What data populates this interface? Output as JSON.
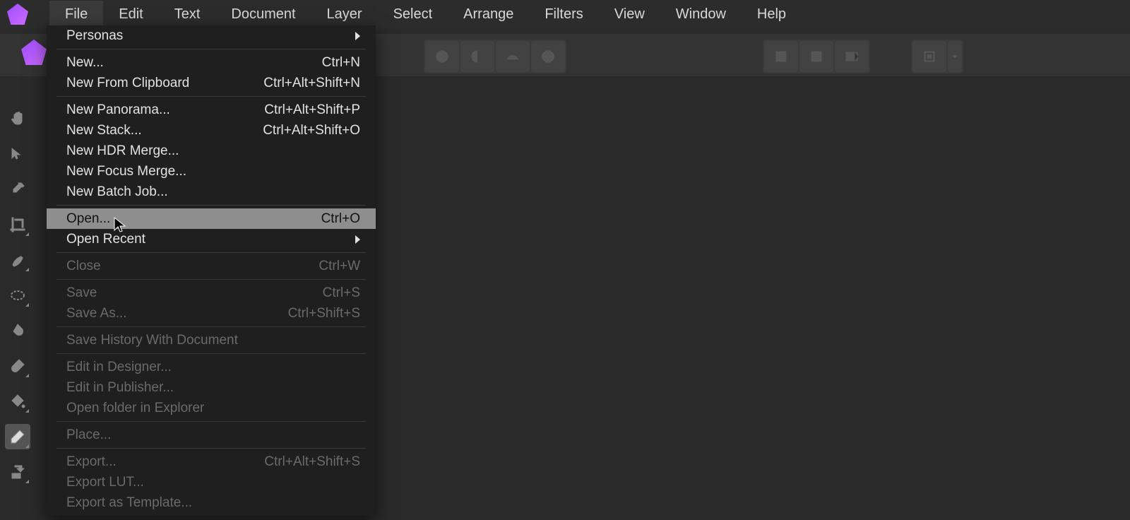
{
  "menubar": {
    "items": [
      {
        "label": "File",
        "active": true
      },
      {
        "label": "Edit"
      },
      {
        "label": "Text"
      },
      {
        "label": "Document"
      },
      {
        "label": "Layer"
      },
      {
        "label": "Select"
      },
      {
        "label": "Arrange"
      },
      {
        "label": "Filters"
      },
      {
        "label": "View"
      },
      {
        "label": "Window"
      },
      {
        "label": "Help"
      }
    ]
  },
  "dropdown": {
    "items": [
      {
        "label": "Personas",
        "submenu": true
      },
      {
        "sep": true
      },
      {
        "label": "New...",
        "shortcut": "Ctrl+N"
      },
      {
        "label": "New From Clipboard",
        "shortcut": "Ctrl+Alt+Shift+N"
      },
      {
        "sep": true
      },
      {
        "label": "New Panorama...",
        "shortcut": "Ctrl+Alt+Shift+P"
      },
      {
        "label": "New Stack...",
        "shortcut": "Ctrl+Alt+Shift+O"
      },
      {
        "label": "New HDR Merge..."
      },
      {
        "label": "New Focus Merge..."
      },
      {
        "label": "New Batch Job..."
      },
      {
        "sep": true
      },
      {
        "label": "Open...",
        "shortcut": "Ctrl+O",
        "highlight": true
      },
      {
        "label": "Open Recent",
        "submenu": true
      },
      {
        "sep": true
      },
      {
        "label": "Close",
        "shortcut": "Ctrl+W",
        "disabled": true
      },
      {
        "sep": true
      },
      {
        "label": "Save",
        "shortcut": "Ctrl+S",
        "disabled": true
      },
      {
        "label": "Save As...",
        "shortcut": "Ctrl+Shift+S",
        "disabled": true
      },
      {
        "sep": true
      },
      {
        "label": "Save History With Document",
        "disabled": true
      },
      {
        "sep": true
      },
      {
        "label": "Edit in Designer...",
        "disabled": true
      },
      {
        "label": "Edit in Publisher...",
        "disabled": true
      },
      {
        "label": "Open folder in Explorer",
        "disabled": true
      },
      {
        "sep": true
      },
      {
        "label": "Place...",
        "disabled": true
      },
      {
        "sep": true
      },
      {
        "label": "Export...",
        "shortcut": "Ctrl+Alt+Shift+S",
        "disabled": true
      },
      {
        "label": "Export LUT...",
        "disabled": true
      },
      {
        "label": "Export as Template...",
        "disabled": true
      }
    ]
  },
  "toolstrip": {
    "tools": [
      {
        "name": "hand-tool-icon"
      },
      {
        "name": "move-tool-icon"
      },
      {
        "name": "color-picker-tool-icon"
      },
      {
        "name": "crop-tool-icon",
        "corner": true
      },
      {
        "name": "selection-brush-tool-icon",
        "corner": true
      },
      {
        "name": "marquee-tool-icon",
        "corner": true
      },
      {
        "name": "flood-select-tool-icon"
      },
      {
        "name": "paint-brush-tool-icon",
        "corner": true
      },
      {
        "name": "fill-tool-icon",
        "corner": true
      },
      {
        "name": "eraser-tool-icon",
        "selected": true,
        "corner": true
      },
      {
        "name": "clone-tool-icon",
        "corner": true
      }
    ]
  }
}
